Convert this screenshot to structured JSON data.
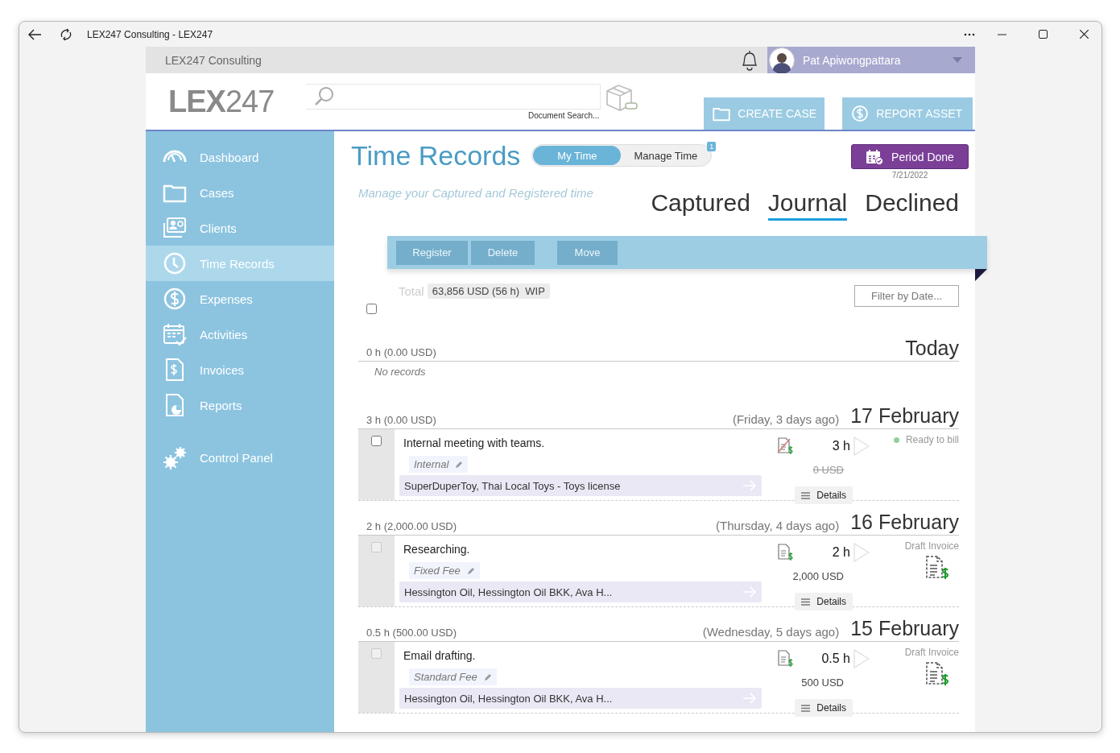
{
  "window": {
    "title": "LEX247 Consulting - LEX247"
  },
  "top_bar": {
    "company": "LEX247 Consulting",
    "user": "Pat Apiwongpattara"
  },
  "header": {
    "logo": "**LEX**247",
    "search_caption": "Document Search...",
    "buttons": [
      {
        "label": "CREATE CASE"
      },
      {
        "label": "REPORT ASSET"
      }
    ]
  },
  "sidebar": {
    "items": [
      {
        "label": "Dashboard",
        "selected": false
      },
      {
        "label": "Cases",
        "selected": false
      },
      {
        "label": "Clients",
        "selected": false
      },
      {
        "label": "Time Records",
        "selected": true
      },
      {
        "label": "Expenses",
        "selected": false
      },
      {
        "label": "Activities",
        "selected": false
      },
      {
        "label": "Invoices",
        "selected": false
      },
      {
        "label": "Reports",
        "selected": false
      },
      {
        "label": "Control Panel",
        "selected": false
      }
    ]
  },
  "page": {
    "title": "Time Records",
    "toggle": [
      {
        "label": "My Time",
        "selected": true
      },
      {
        "label": "Manage Time",
        "selected": false,
        "badge": "1"
      }
    ],
    "period_button": {
      "label": "Period Done",
      "date": "7/21/2022"
    },
    "subtitle": "Manage your Captured and Registered time",
    "tabs": [
      {
        "label": "Captured",
        "selected": false
      },
      {
        "label": "Journal",
        "selected": true
      },
      {
        "label": "Declined",
        "selected": false
      }
    ]
  },
  "toolbar": {
    "buttons": [
      {
        "label": "Register",
        "disabled": true
      },
      {
        "label": "Delete",
        "disabled": true
      },
      {
        "label": "Move",
        "disabled": true
      }
    ]
  },
  "summary": {
    "label": "Total",
    "value": "63,856 USD (56 h)  WIP",
    "select_all": {
      "checked": false
    },
    "filter": {
      "placeholder": "Filter by Date..."
    }
  },
  "days": [
    {
      "hours": "0 h",
      "amount": "(0.00 USD)",
      "date": "Today",
      "empty_text": "No records"
    },
    {
      "hours": "3 h",
      "amount": "(0.00 USD)",
      "weekday": "(Friday, 3 days ago)",
      "date": "17 February",
      "entries": [
        {
          "checked": false,
          "disabled": false,
          "description": "Internal meeting with teams.",
          "fee": "Internal",
          "matter": "SuperDuperToy, Thai Local Toys - Toys license",
          "billable": false,
          "hours": "3 h",
          "amount": "0 USD",
          "struck": true,
          "status": "Ready to bill",
          "kind": "ready",
          "details": "Details"
        }
      ]
    },
    {
      "hours": "2 h",
      "amount": "(2,000.00 USD)",
      "weekday": "(Thursday, 4 days ago)",
      "date": "16 February",
      "entries": [
        {
          "checked": false,
          "disabled": true,
          "description": "Researching.",
          "fee": "Fixed Fee",
          "matter": "Hessington Oil, Hessington Oil BKK, Ava H...",
          "billable": true,
          "hours": "2 h",
          "amount": "2,000 USD",
          "struck": false,
          "status": "Draft Invoice",
          "kind": "draft",
          "details": "Details"
        }
      ]
    },
    {
      "hours": "0.5 h",
      "amount": "(500.00 USD)",
      "weekday": "(Wednesday, 5 days ago)",
      "date": "15 February",
      "entries": [
        {
          "checked": false,
          "disabled": true,
          "description": "Email drafting.",
          "fee": "Standard Fee",
          "matter": "Hessington Oil, Hessington Oil BKK, Ava H...",
          "billable": true,
          "hours": "0.5 h",
          "amount": "500 USD",
          "struck": false,
          "status": "Draft Invoice",
          "kind": "draft",
          "details": "Details"
        }
      ]
    }
  ]
}
